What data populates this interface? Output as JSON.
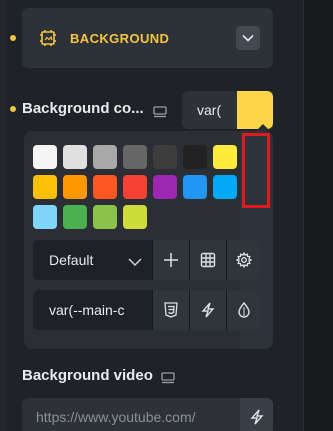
{
  "section": {
    "title": "BACKGROUND",
    "icon": "background-frame-icon",
    "toggle_icon": "chevron-down-icon",
    "accent": "#f5c542"
  },
  "background_color": {
    "label": "Background co...",
    "responsive_icon": "desktop-icon",
    "value": "var(",
    "swatch_color": "#ffd54a"
  },
  "palette": {
    "swatches": [
      {
        "color": "#f5f5f5"
      },
      {
        "color": "#e0e0e0"
      },
      {
        "color": "#a8a8a8"
      },
      {
        "color": "#666666"
      },
      {
        "color": "#3d3d3d"
      },
      {
        "color": "#222222"
      },
      {
        "color": "#ffeb3b"
      },
      {
        "color": "#ffc107"
      },
      {
        "color": "#ff9800"
      },
      {
        "color": "#ff5722"
      },
      {
        "color": "#f44336"
      },
      {
        "color": "#9c27b0"
      },
      {
        "color": "#2196f3"
      },
      {
        "color": "#03a9f4"
      },
      {
        "color": "#81d4fa"
      },
      {
        "color": "#4caf50"
      },
      {
        "color": "#8bc34a"
      },
      {
        "color": "#cddc39"
      }
    ],
    "dropdown_value": "Default",
    "dropdown_icon": "chevron-down-icon",
    "buttons": [
      {
        "name": "add-color-button",
        "icon": "plus-icon"
      },
      {
        "name": "grid-view-button",
        "icon": "grid-icon"
      },
      {
        "name": "palette-settings-button",
        "icon": "gear-icon"
      }
    ],
    "variable_value": "var(--main-c",
    "variable_buttons": [
      {
        "name": "css3-button",
        "icon": "css3-icon"
      },
      {
        "name": "dynamic-data-button",
        "icon": "lightning-icon"
      },
      {
        "name": "color-picker-button",
        "icon": "drop-icon"
      }
    ]
  },
  "background_video": {
    "label": "Background video",
    "responsive_icon": "desktop-icon",
    "placeholder": "https://www.youtube.com/",
    "button_icon": "lightning-icon"
  },
  "highlight": {
    "color": "#e01b1b"
  }
}
